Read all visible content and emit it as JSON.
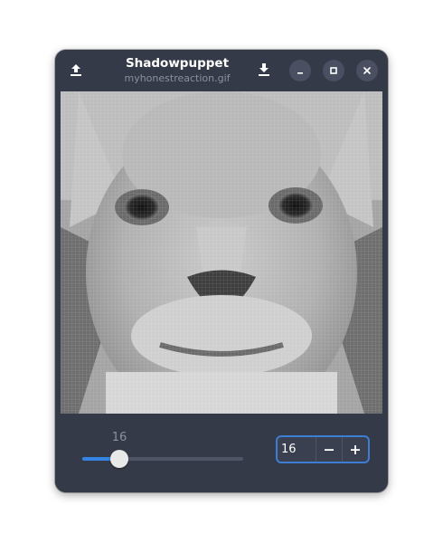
{
  "window": {
    "title": "Shadowpuppet",
    "subtitle": "myhonestreaction.gif"
  },
  "icons": {
    "upload": "upload-icon",
    "download": "download-icon",
    "minimize": "minimize-icon",
    "maximize": "maximize-icon",
    "close": "close-icon",
    "minus": "minus-icon",
    "plus": "plus-icon"
  },
  "controls": {
    "slider_value": "16",
    "slider_fraction": 0.23,
    "spin_value": "16"
  },
  "colors": {
    "window_bg": "#353a48",
    "accent": "#3584e4",
    "button_bg": "#4a5061"
  }
}
